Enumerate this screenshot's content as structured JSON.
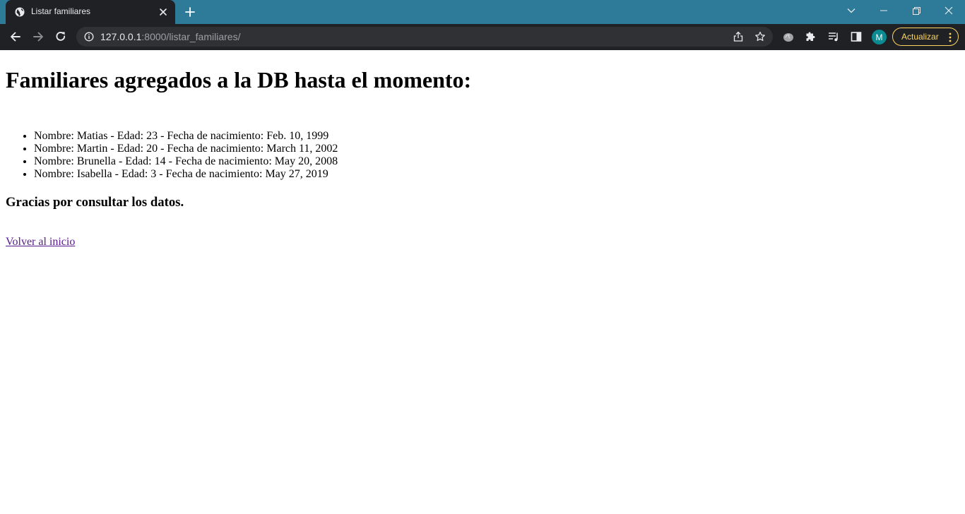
{
  "browser": {
    "tab_title": "Listar familiares",
    "url_host": "127.0.0.1",
    "url_path": ":8000/listar_familiares/",
    "profile_initial": "M",
    "update_label": "Actualizar",
    "colors": {
      "tabstrip": "#2d7a99",
      "toolbar": "#202124",
      "omnibox": "#303134",
      "update_accent": "#fdd663",
      "avatar": "#0b8a92"
    }
  },
  "page": {
    "heading": "Familiares agregados a la DB hasta el momento:",
    "familiares": [
      "Nombre: Matias - Edad: 23 - Fecha de nacimiento: Feb. 10, 1999",
      "Nombre: Martin - Edad: 20 - Fecha de nacimiento: March 11, 2002",
      "Nombre: Brunella - Edad: 14 - Fecha de nacimiento: May 20, 2008",
      "Nombre: Isabella - Edad: 3 - Fecha de nacimiento: May 27, 2019"
    ],
    "thanks": "Gracias por consultar los datos.",
    "back_link": "Volver al inicio",
    "link_color": "#551a8b"
  }
}
